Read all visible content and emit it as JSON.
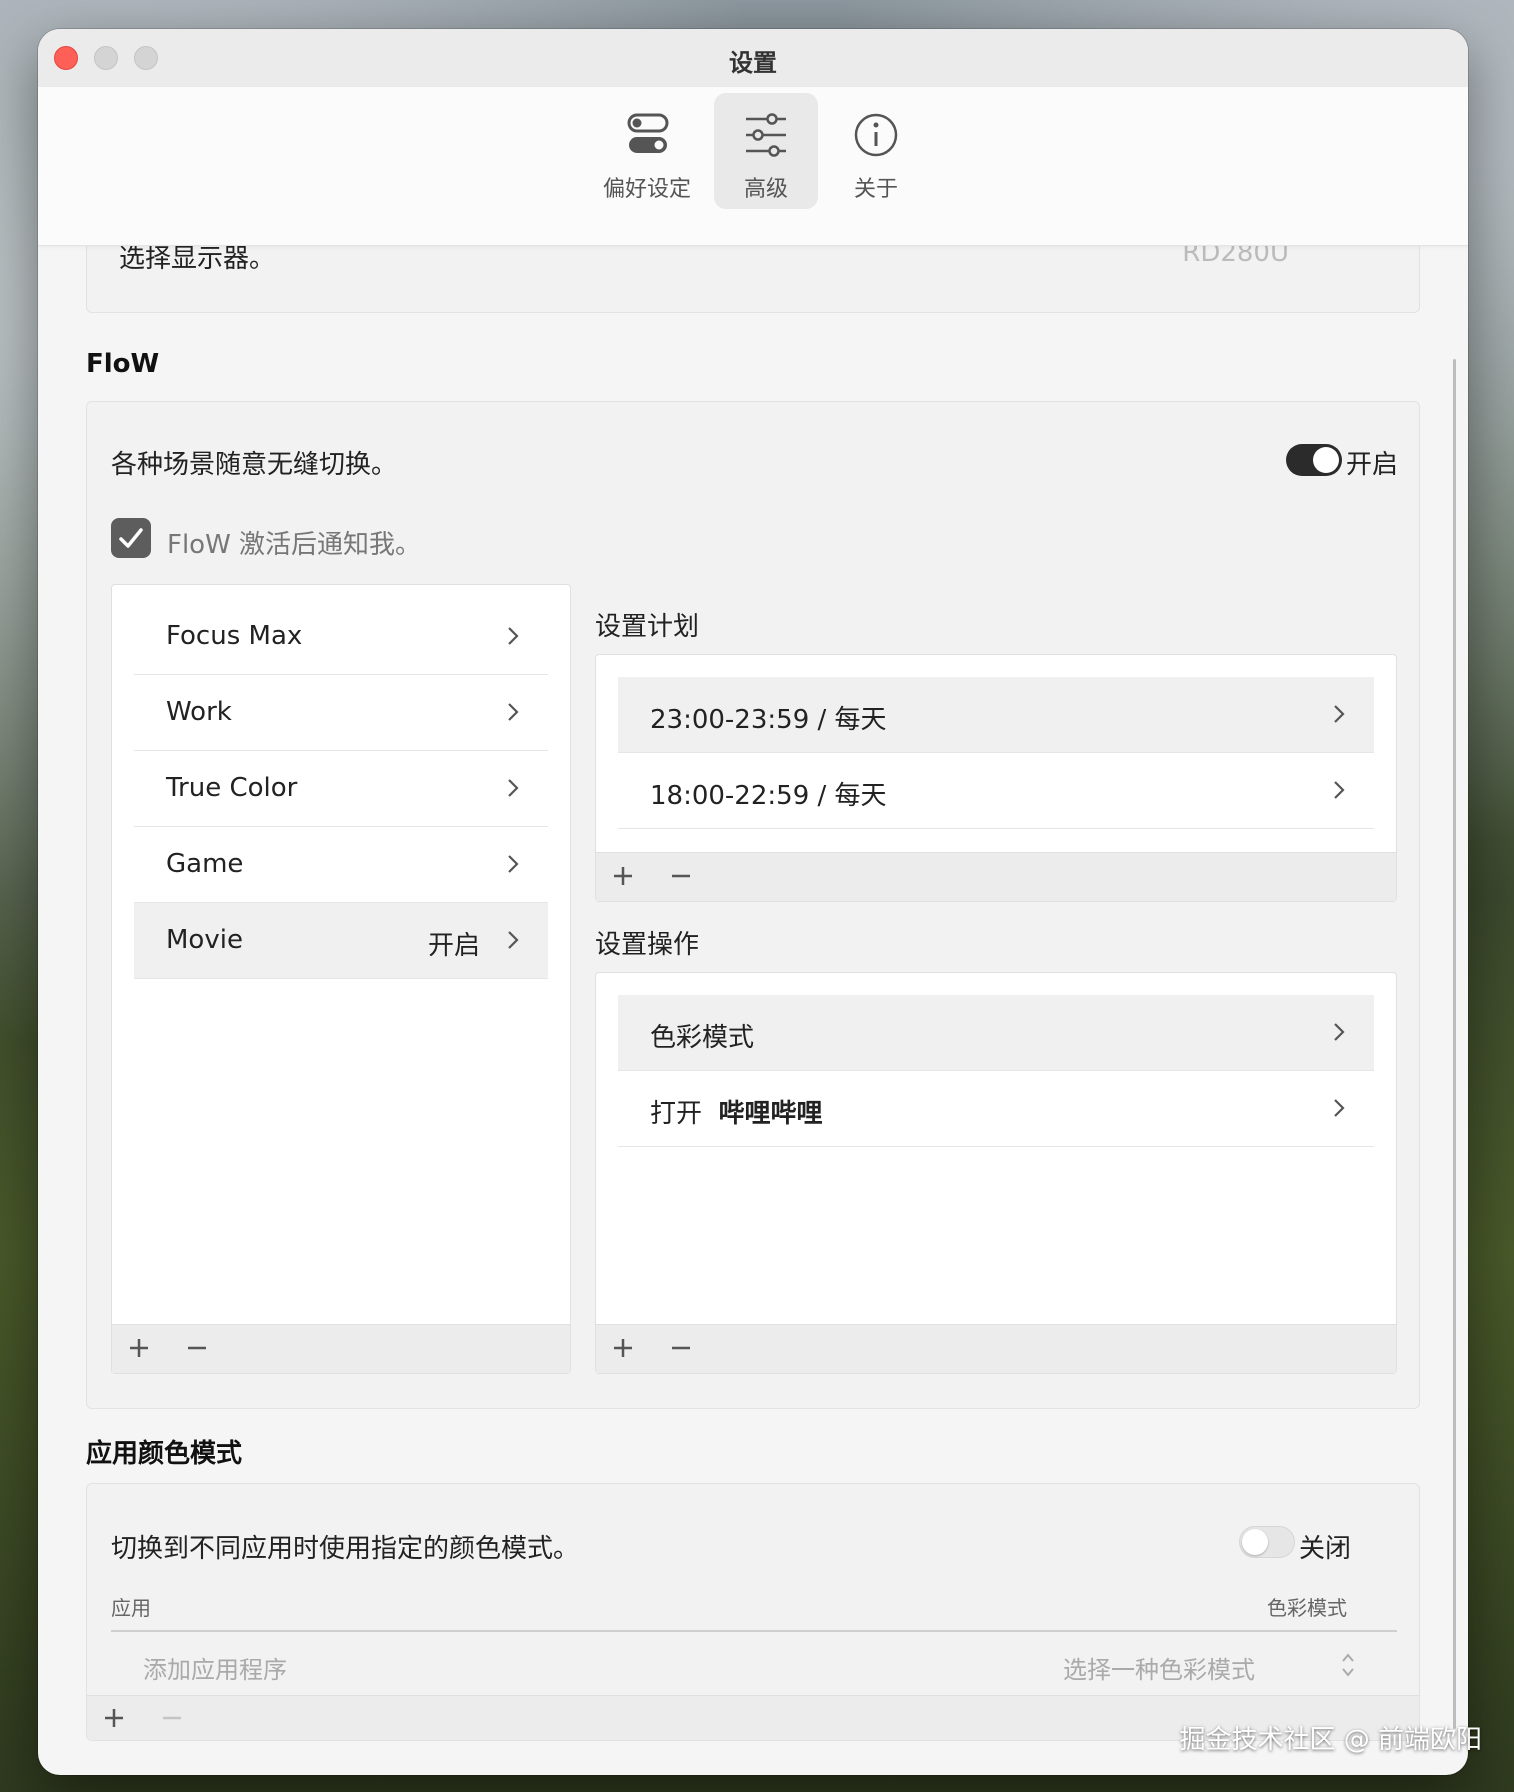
{
  "window": {
    "title": "设置"
  },
  "toolbar": {
    "items": [
      {
        "label": "偏好设定",
        "icon": "toggle-preferences-icon"
      },
      {
        "label": "高级",
        "icon": "sliders-icon",
        "active": true
      },
      {
        "label": "关于",
        "icon": "info-icon"
      }
    ]
  },
  "display": {
    "label": "选择显示器。",
    "value": "RD280U"
  },
  "flow": {
    "title": "FloW",
    "description": "各种场景随意无缝切换。",
    "toggle_state": "开启",
    "notify_label": "FloW 激活后通知我。",
    "notify_checked": true,
    "scenes": [
      {
        "name": "Focus Max",
        "state": ""
      },
      {
        "name": "Work",
        "state": ""
      },
      {
        "name": "True Color",
        "state": ""
      },
      {
        "name": "Game",
        "state": ""
      },
      {
        "name": "Movie",
        "state": "开启",
        "selected": true
      }
    ],
    "schedule_title": "设置计划",
    "schedules": [
      {
        "time": "23:00-23:59",
        "repeat": "/ 每天"
      },
      {
        "time": "18:00-22:59",
        "repeat": "/ 每天"
      }
    ],
    "actions_title": "设置操作",
    "actions": [
      {
        "label": "色彩模式",
        "target": ""
      },
      {
        "label": "打开",
        "target": "哔哩哔哩"
      }
    ]
  },
  "app_color": {
    "title": "应用颜色模式",
    "description": "切换到不同应用时使用指定的颜色模式。",
    "toggle_state": "关闭",
    "col_app": "应用",
    "col_mode": "色彩模式",
    "add_app_placeholder": "添加应用程序",
    "mode_placeholder": "选择一种色彩模式"
  },
  "watermark": "掘金技术社区 @ 前端欧阳"
}
